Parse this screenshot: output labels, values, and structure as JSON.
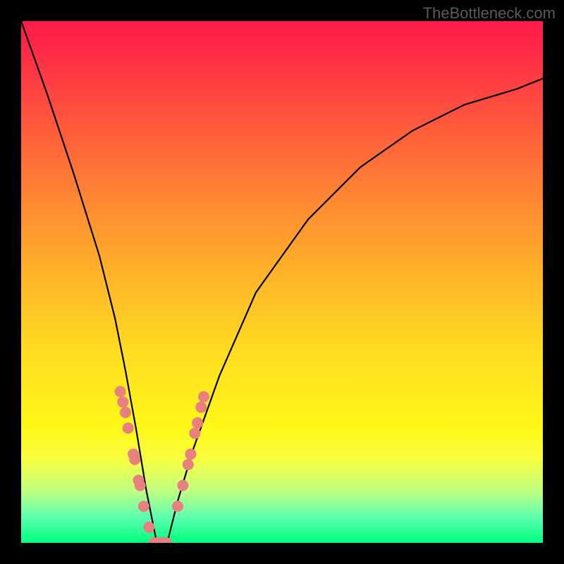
{
  "chart_data": {
    "type": "line",
    "title": "",
    "xlabel": "",
    "ylabel": "",
    "watermark": "TheBottleneck.com",
    "series": [
      {
        "name": "bottleneck-curve",
        "description": "V-shaped curve showing bottleneck percentage; minimum near x≈0.26 where bottleneck ~0%, rising steeply on both sides toward 100%",
        "x": [
          0.0,
          0.05,
          0.1,
          0.15,
          0.18,
          0.2,
          0.22,
          0.24,
          0.26,
          0.28,
          0.3,
          0.33,
          0.38,
          0.45,
          0.55,
          0.65,
          0.75,
          0.85,
          0.95,
          1.0
        ],
        "y": [
          100,
          86,
          71,
          55,
          43,
          33,
          22,
          10,
          0,
          0,
          8,
          18,
          32,
          48,
          62,
          72,
          79,
          84,
          87,
          89
        ]
      }
    ],
    "markers": {
      "description": "salmon-colored data point markers clustered near the trough of the V",
      "color": "#e98080",
      "points": [
        {
          "x": 0.19,
          "y": 29
        },
        {
          "x": 0.195,
          "y": 27
        },
        {
          "x": 0.2,
          "y": 25
        },
        {
          "x": 0.205,
          "y": 22
        },
        {
          "x": 0.215,
          "y": 17
        },
        {
          "x": 0.218,
          "y": 16
        },
        {
          "x": 0.225,
          "y": 12
        },
        {
          "x": 0.228,
          "y": 11
        },
        {
          "x": 0.235,
          "y": 7
        },
        {
          "x": 0.245,
          "y": 3
        },
        {
          "x": 0.255,
          "y": 0
        },
        {
          "x": 0.262,
          "y": 0
        },
        {
          "x": 0.27,
          "y": 0
        },
        {
          "x": 0.278,
          "y": 0
        },
        {
          "x": 0.3,
          "y": 7
        },
        {
          "x": 0.31,
          "y": 11
        },
        {
          "x": 0.32,
          "y": 15
        },
        {
          "x": 0.325,
          "y": 17
        },
        {
          "x": 0.333,
          "y": 21
        },
        {
          "x": 0.338,
          "y": 23
        },
        {
          "x": 0.345,
          "y": 26
        },
        {
          "x": 0.35,
          "y": 28
        }
      ]
    },
    "xlim": [
      0,
      1
    ],
    "ylim": [
      0,
      100
    ],
    "background_gradient": {
      "top_color": "#ff1a4a",
      "bottom_color": "#00ff80",
      "meaning": "red = high bottleneck, green = low bottleneck"
    }
  }
}
